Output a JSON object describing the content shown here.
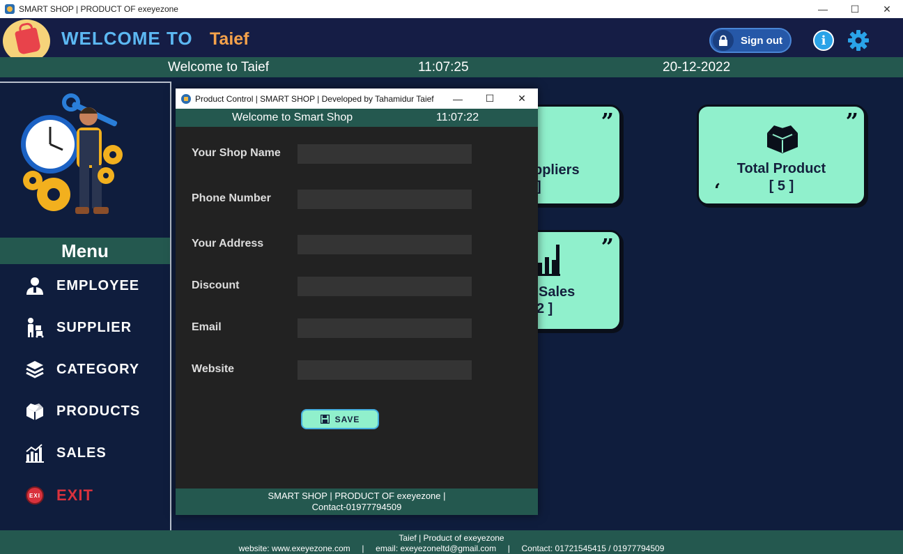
{
  "window": {
    "title": "SMART SHOP | PRODUCT OF exeyezone",
    "minimize": "—",
    "maximize": "☐",
    "close": "✕"
  },
  "header": {
    "welcome_to": "WELCOME TO",
    "user_name": "Taief",
    "sign_out": "Sign out",
    "info_label": "i"
  },
  "status": {
    "welcome": "Welcome to Taief",
    "time": "11:07:25",
    "date": "20-12-2022"
  },
  "sidebar": {
    "menu_title": "Menu",
    "items": [
      {
        "label": "EMPLOYEE",
        "icon": "employee-icon"
      },
      {
        "label": "SUPPLIER",
        "icon": "supplier-icon"
      },
      {
        "label": "CATEGORY",
        "icon": "category-icon"
      },
      {
        "label": "PRODUCTS",
        "icon": "products-icon"
      },
      {
        "label": "SALES",
        "icon": "sales-icon"
      },
      {
        "label": "EXIT",
        "icon": "exit-icon",
        "icon_text": "EXI"
      }
    ]
  },
  "cards": [
    {
      "label": "ppliers",
      "value": "]"
    },
    {
      "label": "Total Product",
      "value": "[ 5 ]"
    },
    {
      "label": "Sales",
      "value": "2 ]"
    }
  ],
  "dialog": {
    "title": "Product Control  |  SMART SHOP | Developed by Tahamidur Taief",
    "minimize": "—",
    "maximize": "☐",
    "close": "✕",
    "welcome": "Welcome to Smart Shop",
    "time": "11:07:22",
    "fields": [
      {
        "label": "Your Shop Name",
        "value": ""
      },
      {
        "label": "Phone Number",
        "value": ""
      },
      {
        "label": "Your Address",
        "value": ""
      },
      {
        "label": "Discount",
        "value": ""
      },
      {
        "label": "Email",
        "value": ""
      },
      {
        "label": "Website",
        "value": ""
      }
    ],
    "save_label": "SAVE",
    "footer_line1": "SMART SHOP | PRODUCT OF exeyezone |",
    "footer_line2": "Contact-01977794509"
  },
  "footer": {
    "line1": "Taief | Product of exeyezone",
    "line2": "website: www.exeyezone.com     |     email: exeyezoneltd@gmail.com     |     Contact: 01721545415 / 01977794509"
  },
  "colors": {
    "background": "#0f1d3d",
    "header": "#151d45",
    "teal_bar": "#24584f",
    "card": "#90f0cc",
    "accent_blue": "#5cb8f2",
    "accent_orange": "#f5a24b",
    "exit_red": "#d9323d"
  }
}
